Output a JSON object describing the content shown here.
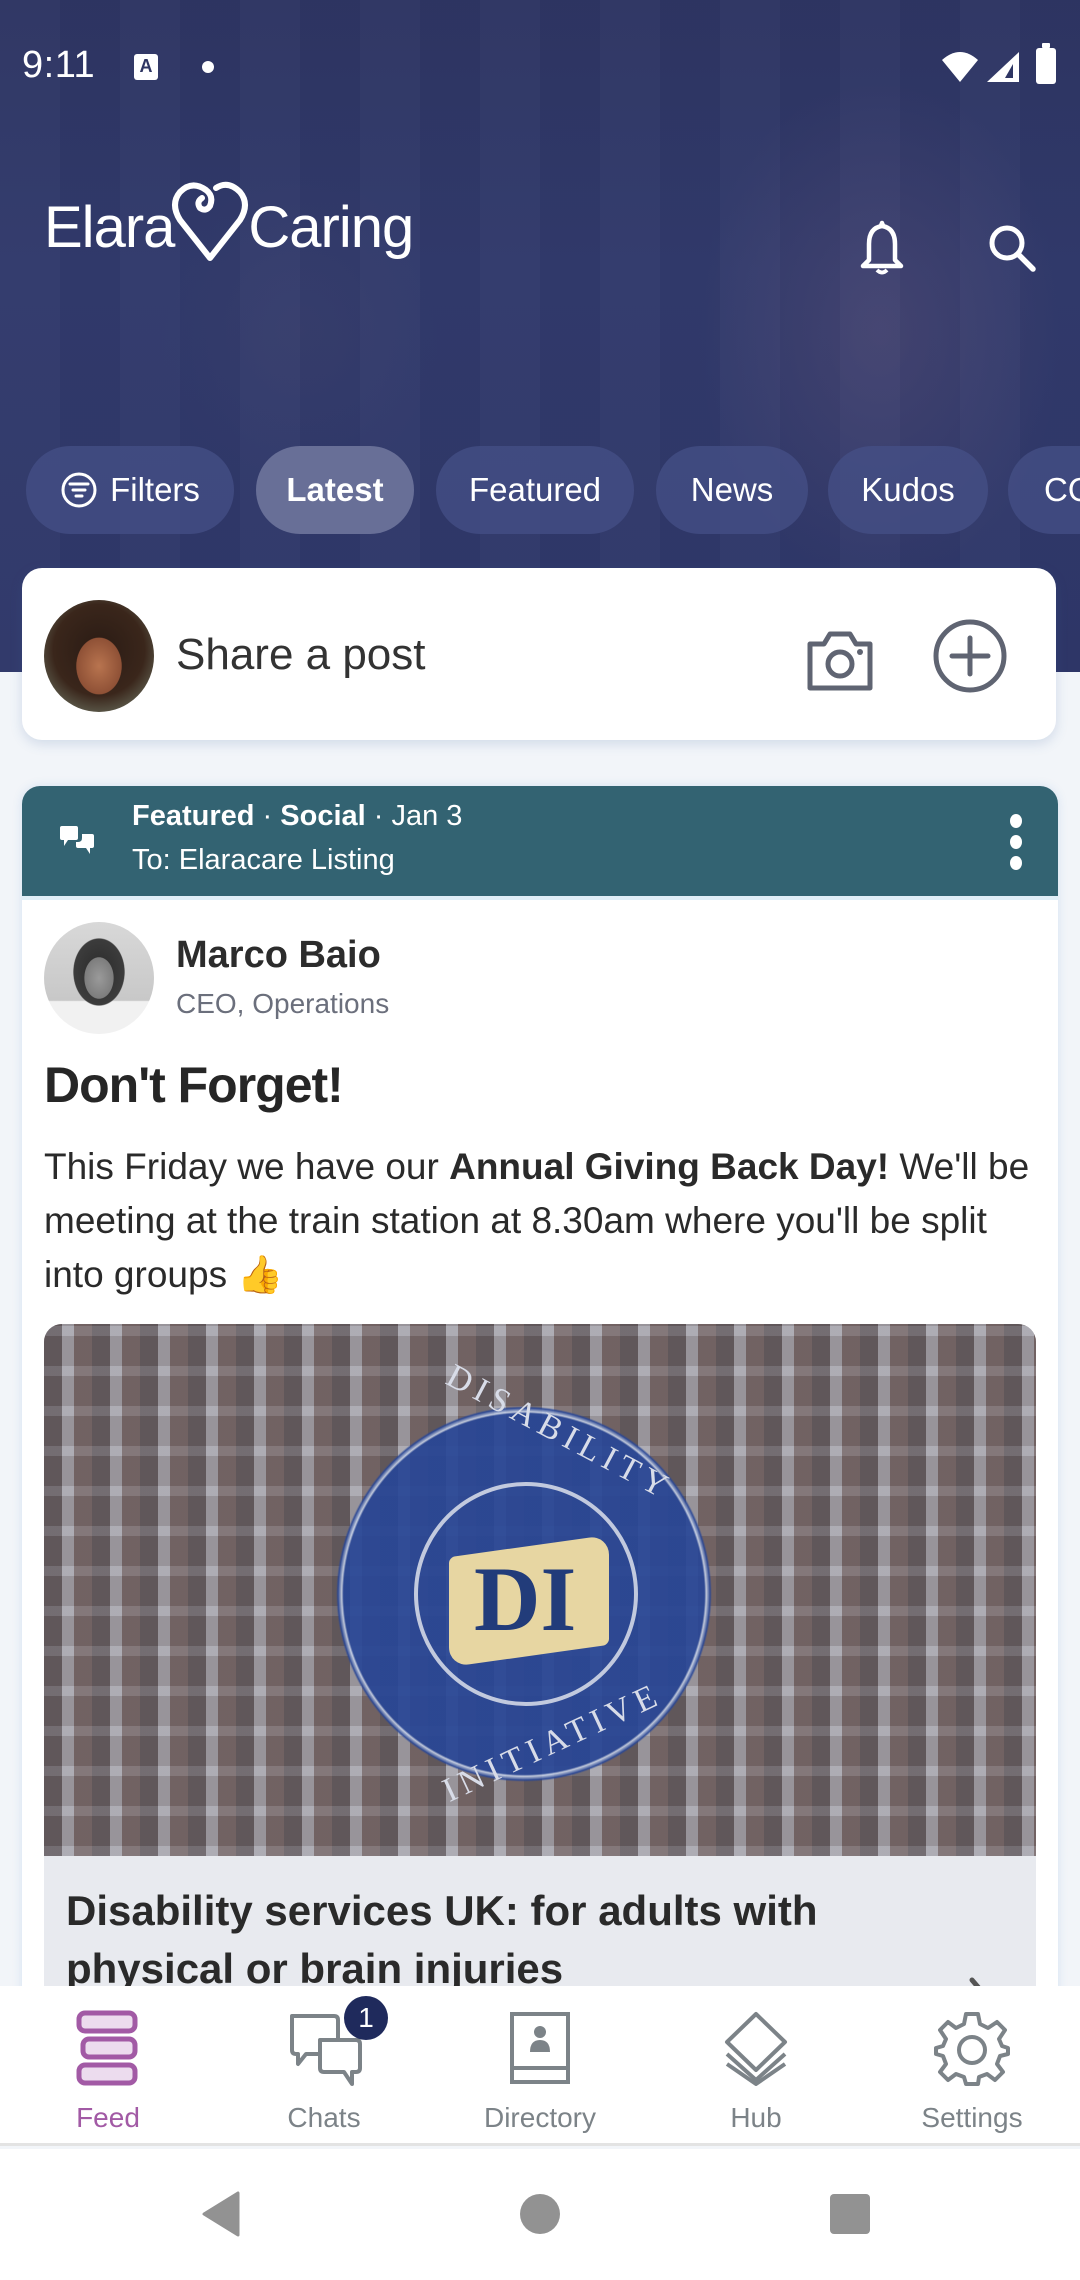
{
  "status_bar": {
    "time": "9:11",
    "notification_icon": "A",
    "icons": [
      "wifi-icon",
      "signal-icon",
      "battery-icon"
    ]
  },
  "header": {
    "logo_left": "Elara",
    "logo_right": "Caring",
    "icons": [
      "bell-icon",
      "search-icon"
    ]
  },
  "chips": {
    "filters": "Filters",
    "items": [
      {
        "label": "Latest",
        "active": true
      },
      {
        "label": "Featured",
        "active": false
      },
      {
        "label": "News",
        "active": false
      },
      {
        "label": "Kudos",
        "active": false
      },
      {
        "label": "CO",
        "active": false
      }
    ]
  },
  "composer": {
    "placeholder": "Share a post"
  },
  "post": {
    "category_featured": "Featured",
    "category_social": "Social",
    "date": "Jan 3",
    "separator": " · ",
    "audience": "To: Elaracare Listing",
    "author_name": "Marco Baio",
    "author_role": "CEO, Operations",
    "title": "Don't Forget!",
    "body_before": "This Friday we have our ",
    "body_bold": "Annual Giving Back Day!",
    "body_after": " We'll be meeting at the train station at 8.30am where you'll be split into groups 👍",
    "link_preview": {
      "image_text_top": "DISABILITY",
      "image_text_bottom": "INITIATIVE",
      "image_monogram": "DI",
      "title": "Disability services UK: for adults with physical or brain injuries"
    }
  },
  "bottom_nav": {
    "items": [
      {
        "label": "Feed",
        "active": true
      },
      {
        "label": "Chats",
        "active": false,
        "badge": "1"
      },
      {
        "label": "Directory",
        "active": false
      },
      {
        "label": "Hub",
        "active": false
      },
      {
        "label": "Settings",
        "active": false
      }
    ]
  },
  "colors": {
    "header_bg": "#2f3769",
    "post_topbar": "#336372",
    "active_nav": "#a25aa5",
    "badge": "#1f2a5c"
  }
}
